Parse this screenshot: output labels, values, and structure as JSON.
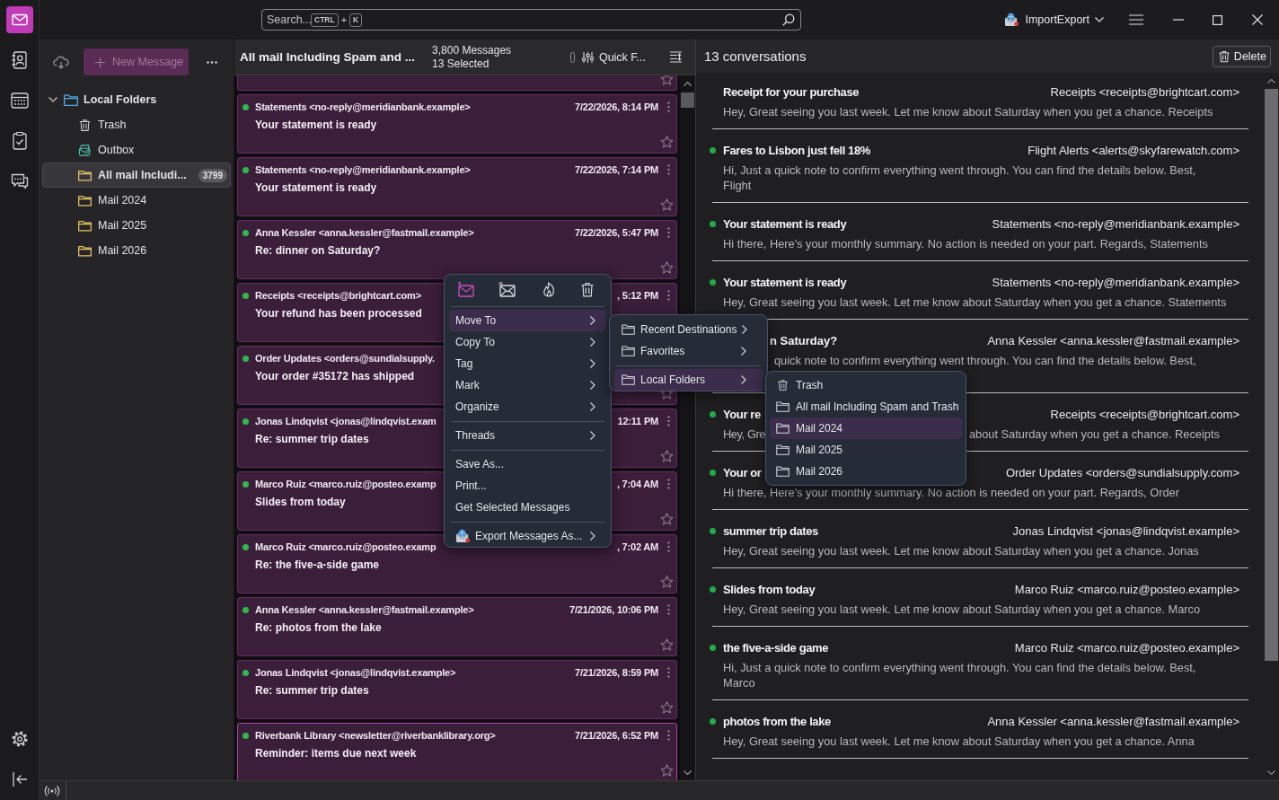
{
  "app_rail": {
    "items": [
      {
        "selected": true
      },
      {
        "selected": false
      },
      {
        "selected": false
      },
      {
        "selected": false
      },
      {
        "selected": false
      }
    ]
  },
  "search": {
    "placeholder": "Search...",
    "shortcut_keys": [
      "CTRL",
      "K"
    ],
    "shortcut_joiner": "+"
  },
  "account": {
    "label": "ImportExport"
  },
  "folder_pane": {
    "new_message": {
      "label": "New Message",
      "disabled": true
    },
    "folders": [
      {
        "name": "Local Folders",
        "kind": "root",
        "expanded": true,
        "selected": false,
        "children": [
          {
            "name": "Trash",
            "kind": "trash",
            "selected": false
          },
          {
            "name": "Outbox",
            "kind": "outbox",
            "selected": false
          },
          {
            "name": "All mail Includi...",
            "kind": "folder",
            "selected": true,
            "count": "3799"
          },
          {
            "name": "Mail 2024",
            "kind": "folder",
            "selected": false
          },
          {
            "name": "Mail 2025",
            "kind": "folder",
            "selected": false
          },
          {
            "name": "Mail 2026",
            "kind": "folder",
            "selected": false
          }
        ]
      }
    ]
  },
  "message_list": {
    "title": "All mail Including Spam and ...",
    "total": "3,800 Messages",
    "selection": "13 Selected",
    "quick_filter": "Quick F...",
    "cards": [
      {
        "sender": "Statements <no-reply@meridianbank.example>",
        "date": "7/22/2026, 8:14 PM",
        "subject": "Your statement is ready",
        "unread": true,
        "selected": true,
        "focused": false
      },
      {
        "sender": "Statements <no-reply@meridianbank.example>",
        "date": "7/22/2026, 7:14 PM",
        "subject": "Your statement is ready",
        "unread": true,
        "selected": true,
        "focused": false
      },
      {
        "sender": "Anna Kessler <anna.kessler@fastmail.example>",
        "date": "7/22/2026, 5:47 PM",
        "subject": "Re: dinner on Saturday?",
        "unread": true,
        "selected": true,
        "focused": false
      },
      {
        "sender": "Receipts <receipts@brightcart.com>",
        "date": ", 5:12 PM",
        "subject": "Your refund has been processed",
        "unread": true,
        "selected": true,
        "focused": false
      },
      {
        "sender": "Order Updates <orders@sundialsupply.",
        "subject": "Your order #35172 has shipped",
        "unread": true,
        "selected": true,
        "focused": false
      },
      {
        "sender": "Jonas Lindqvist <jonas@lindqvist.exam",
        "date": "12:11 PM",
        "subject": "Re: summer trip dates",
        "unread": true,
        "selected": true,
        "focused": false
      },
      {
        "sender": "Marco Ruiz <marco.ruiz@posteo.examp",
        "date": ", 7:04 AM",
        "subject": "Slides from today",
        "unread": true,
        "selected": true,
        "focused": false
      },
      {
        "sender": "Marco Ruiz <marco.ruiz@posteo.examp",
        "date": ", 7:02 AM",
        "subject": "Re: the five-a-side game",
        "unread": true,
        "selected": true,
        "focused": false
      },
      {
        "sender": "Anna Kessler <anna.kessler@fastmail.example>",
        "date": "7/21/2026, 10:06 PM",
        "subject": "Re: photos from the lake",
        "unread": true,
        "selected": true,
        "focused": false
      },
      {
        "sender": "Jonas Lindqvist <jonas@lindqvist.example>",
        "date": "7/21/2026, 8:59 PM",
        "subject": "Re: summer trip dates",
        "unread": true,
        "selected": true,
        "focused": false
      },
      {
        "sender": "Riverbank Library <newsletter@riverbanklibrary.org>",
        "date": "7/21/2026, 6:52 PM",
        "subject": "Reminder: items due next week",
        "unread": true,
        "selected": true,
        "focused": true
      }
    ]
  },
  "conversation_pane": {
    "title": "13 conversations",
    "delete_label": "Delete",
    "rows": [
      {
        "subject": "Receipt for your purchase",
        "sender": "Receipts <receipts@brightcart.com>",
        "preview": "Hey, Great seeing you last week. Let me know about Saturday when you get a chance. Receipts",
        "unread": false
      },
      {
        "subject": "Fares to Lisbon just fell 18%",
        "sender": "Flight Alerts <alerts@skyfarewatch.com>",
        "preview": "Hi, Just a quick note to confirm everything went through. You can find the details below. Best,\nFlight",
        "unread": true
      },
      {
        "subject": "Your statement is ready",
        "sender": "Statements <no-reply@meridianbank.example>",
        "preview": "Hi there, Here's your monthly summary. No action is needed on your part. Regards, Statements",
        "unread": true
      },
      {
        "subject": "Your statement is ready",
        "sender": "Statements <no-reply@meridianbank.example>",
        "preview": "Hey, Great seeing you last week. Let me know about Saturday when you get a chance. Statements",
        "unread": true
      },
      {
        "subject_end": "n Saturday?",
        "sender": "Anna Kessler <anna.kessler@fastmail.example>",
        "preview_end": "quick note to confirm everything went through. You can find the details below. Best,"
      },
      {
        "subject": "Your re",
        "sender": "Receipts <receipts@brightcart.com>",
        "preview": "Hey, Gre",
        "preview_end": "about Saturday when you get a chance. Receipts",
        "unread": true
      },
      {
        "subject": "Your or",
        "sender": "Order Updates <orders@sundialsupply.com>",
        "preview": "Hi there, Here's your monthly summary. No action is needed on your part. Regards, Order",
        "unread": true
      },
      {
        "subject": "summer trip dates",
        "sender": "Jonas Lindqvist <jonas@lindqvist.example>",
        "preview": "Hey, Great seeing you last week. Let me know about Saturday when you get a chance. Jonas",
        "unread": true
      },
      {
        "subject": "Slides from today",
        "sender": "Marco Ruiz <marco.ruiz@posteo.example>",
        "preview": "Hey, Great seeing you last week. Let me know about Saturday when you get a chance. Marco",
        "unread": true
      },
      {
        "subject": "the five-a-side game",
        "sender": "Marco Ruiz <marco.ruiz@posteo.example>",
        "preview": "Hi, Just a quick note to confirm everything went through. You can find the details below. Best,\nMarco",
        "unread": true
      },
      {
        "subject": "photos from the lake",
        "sender": "Anna Kessler <anna.kessler@fastmail.example>",
        "preview": "Hey, Great seeing you last week. Let me know about Saturday when you get a chance. Anna",
        "unread": true
      }
    ]
  },
  "context_menu": {
    "items": [
      {
        "kind": "entry",
        "label": "Move To",
        "submenu": true,
        "selected": true
      },
      {
        "kind": "entry",
        "label": "Copy To",
        "submenu": true,
        "selected": false
      },
      {
        "kind": "entry",
        "label": "Tag",
        "submenu": true,
        "selected": false
      },
      {
        "kind": "entry",
        "label": "Mark",
        "submenu": true,
        "selected": false
      },
      {
        "kind": "entry",
        "label": "Organize",
        "submenu": true,
        "selected": false
      },
      {
        "kind": "separator"
      },
      {
        "kind": "entry",
        "label": "Threads",
        "submenu": true,
        "selected": false
      },
      {
        "kind": "separator"
      },
      {
        "kind": "entry",
        "label": "Save As...",
        "submenu": false,
        "selected": false
      },
      {
        "kind": "entry",
        "label": "Print...",
        "submenu": false,
        "selected": false
      },
      {
        "kind": "entry",
        "label": "Get Selected Messages",
        "submenu": false,
        "selected": false
      },
      {
        "kind": "separator"
      },
      {
        "kind": "export",
        "label": "Export Messages As...",
        "submenu": true,
        "selected": false
      }
    ]
  },
  "move_submenu": {
    "items": [
      {
        "kind": "folder",
        "label": "Recent Destinations",
        "submenu": true,
        "selected": false
      },
      {
        "kind": "folder",
        "label": "Favorites",
        "submenu": true,
        "selected": false
      },
      {
        "kind": "separator"
      },
      {
        "kind": "folder",
        "label": "Local Folders",
        "submenu": true,
        "selected": true
      }
    ]
  },
  "folder_submenu": {
    "items": [
      {
        "kind": "trash",
        "label": "Trash",
        "submenu": false,
        "selected": false
      },
      {
        "kind": "folder",
        "label": "All mail Including Spam and Trash",
        "submenu": false,
        "selected": false
      },
      {
        "kind": "folder",
        "label": "Mail 2024",
        "submenu": false,
        "selected": true
      },
      {
        "kind": "folder",
        "label": "Mail 2025",
        "submenu": false,
        "selected": false
      },
      {
        "kind": "folder",
        "label": "Mail 2026",
        "submenu": false,
        "selected": false
      }
    ]
  }
}
